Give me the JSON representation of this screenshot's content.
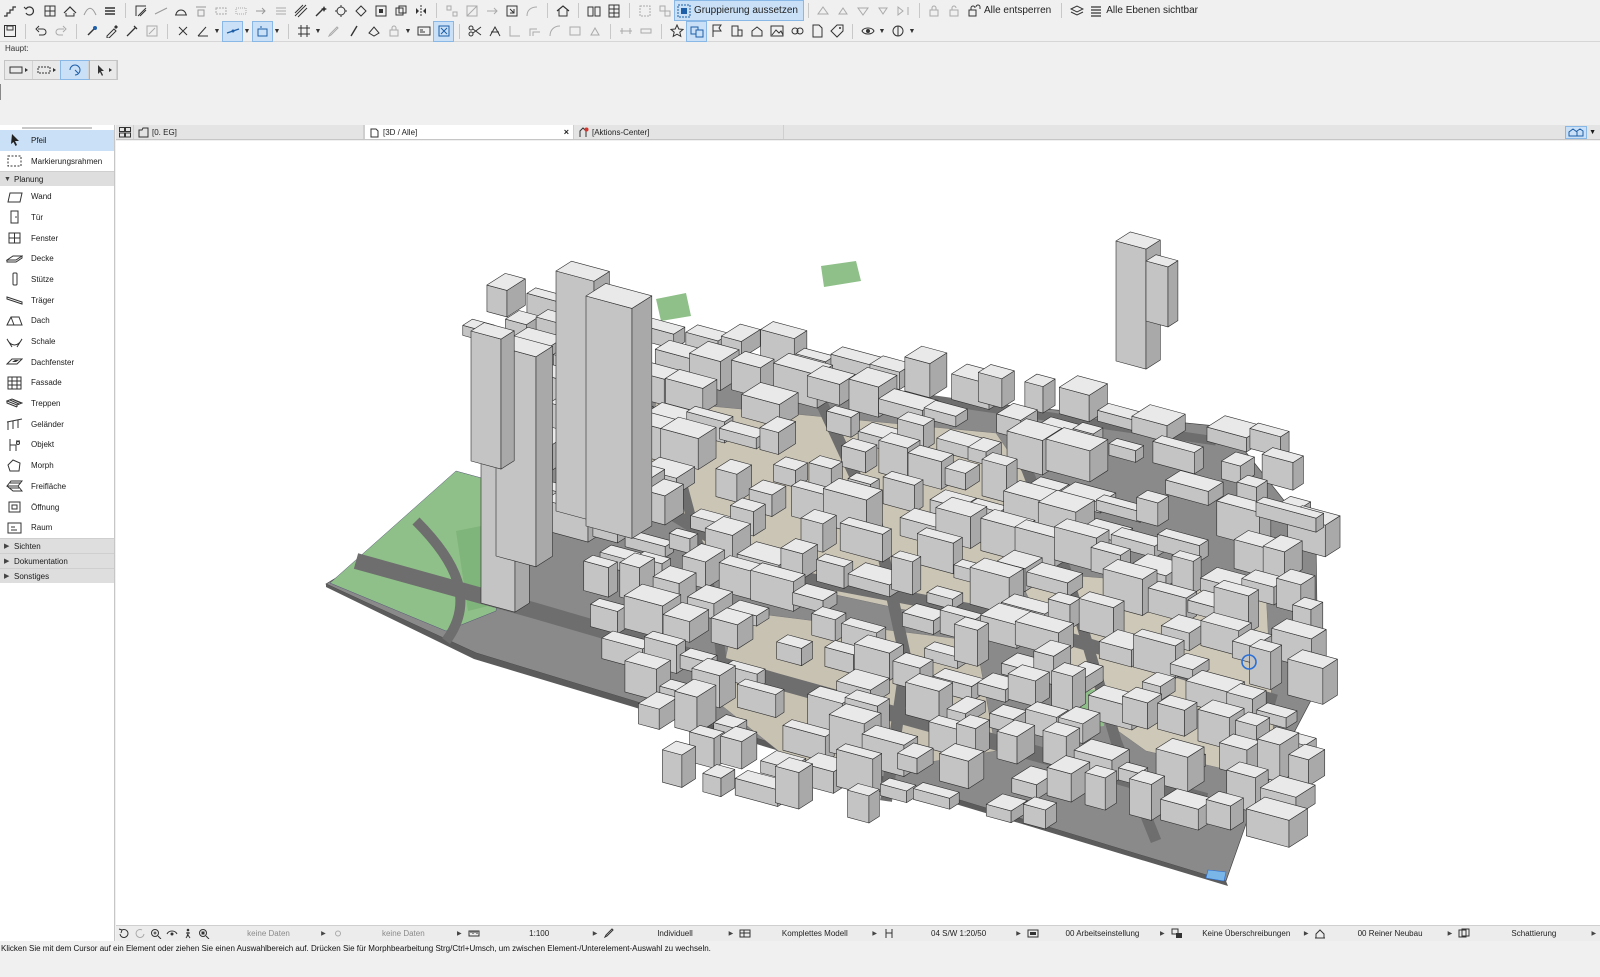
{
  "toolbar": {
    "suspend_groups_label": "Gruppierung aussetzen",
    "unlock_all_label": "Alle entsperren",
    "all_layers_visible_label": "Alle Ebenen sichtbar"
  },
  "palette": {
    "title": "Haupt:"
  },
  "tabs": [
    {
      "label": "[0. EG]"
    },
    {
      "label": "[3D / Alle]",
      "close": "×"
    },
    {
      "label": "[Aktions-Center]"
    }
  ],
  "toolbox": {
    "top_tools": [
      {
        "label": "Pfeil",
        "icon": "arrow-pointer-icon",
        "selected": true
      },
      {
        "label": "Markierungsrahmen",
        "icon": "marquee-icon"
      }
    ],
    "section_planung": "Planung",
    "planung_tools": [
      {
        "label": "Wand",
        "icon": "wall-icon"
      },
      {
        "label": "Tür",
        "icon": "door-icon"
      },
      {
        "label": "Fenster",
        "icon": "window-icon"
      },
      {
        "label": "Decke",
        "icon": "slab-icon"
      },
      {
        "label": "Stütze",
        "icon": "column-icon"
      },
      {
        "label": "Träger",
        "icon": "beam-icon"
      },
      {
        "label": "Dach",
        "icon": "roof-icon"
      },
      {
        "label": "Schale",
        "icon": "shell-icon"
      },
      {
        "label": "Dachfenster",
        "icon": "skylight-icon"
      },
      {
        "label": "Fassade",
        "icon": "curtain-wall-icon"
      },
      {
        "label": "Treppen",
        "icon": "stair-icon"
      },
      {
        "label": "Geländer",
        "icon": "railing-icon"
      },
      {
        "label": "Objekt",
        "icon": "object-icon"
      },
      {
        "label": "Morph",
        "icon": "morph-icon"
      },
      {
        "label": "Freifläche",
        "icon": "mesh-icon"
      },
      {
        "label": "Öffnung",
        "icon": "opening-icon"
      },
      {
        "label": "Raum",
        "icon": "zone-icon"
      }
    ],
    "collapsed_sections": [
      "Sichten",
      "Dokumentation",
      "Sonstiges"
    ]
  },
  "quick_options": {
    "layer_combo_1": "keine Daten",
    "layer_combo_2": "keine Daten",
    "scale": "1:100",
    "pen_set": "Individuell",
    "model_view": "Komplettes Modell",
    "dimension": "04 S/W 1:20/50",
    "graphic_override": "00 Arbeitseinstellung",
    "overrides": "Keine Überschreibungen",
    "renovation": "00 Reiner Neubau",
    "rendering": "Schattierung"
  },
  "status": {
    "message": "Klicken Sie mit dem Cursor auf ein Element oder ziehen Sie einen Auswahlbereich auf. Drücken Sie für Morphbearbeitung Strg/Ctrl+Umsch, um zwischen Element-/Unterelement-Auswahl zu wechseln."
  },
  "colors": {
    "selection": "#c9e0f7",
    "ground": "#858585",
    "street": "#6f6f6f",
    "paved": "#cbc6b8",
    "grass": "#8fc089",
    "building_roof": "#e9e9e9",
    "building_side": "#a9a9a9"
  }
}
